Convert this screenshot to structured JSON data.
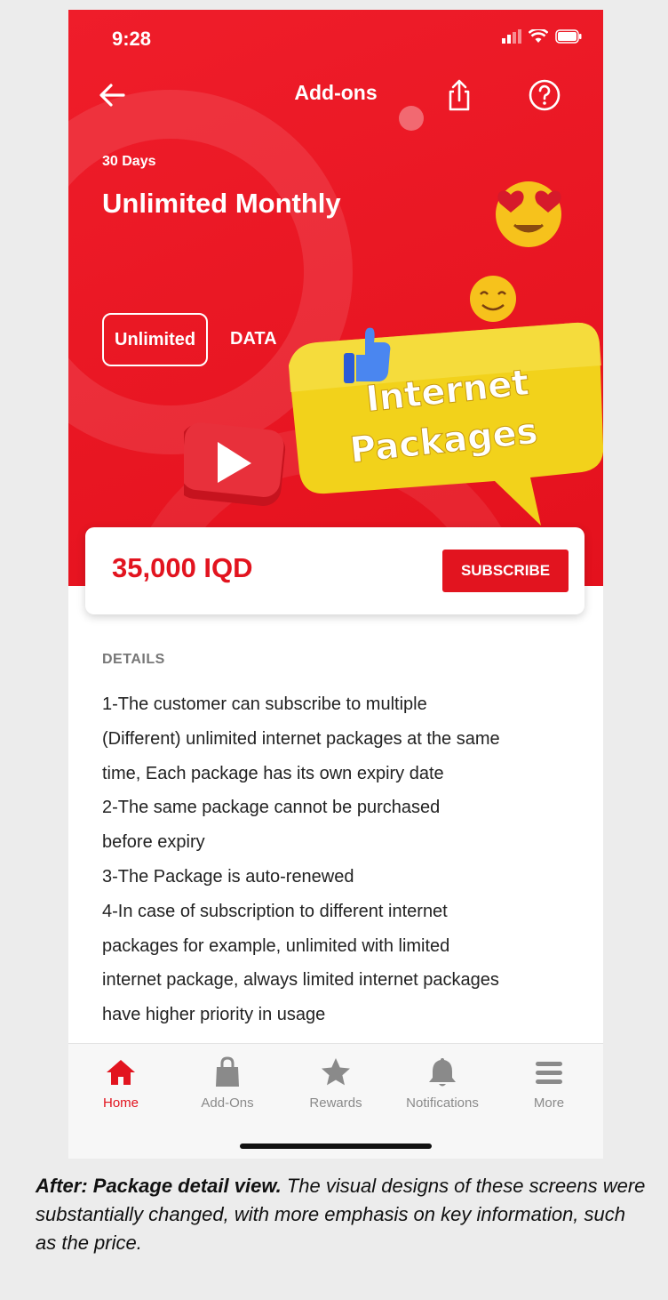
{
  "status": {
    "time": "9:28"
  },
  "header": {
    "title": "Add-ons"
  },
  "package": {
    "validity": "30 Days",
    "name": "Unlimited Monthly",
    "allowance_chip": "Unlimited",
    "allowance_type": "DATA",
    "price": "35,000 IQD",
    "subscribe_label": "SUBSCRIBE"
  },
  "promo": {
    "line1": "Internet",
    "line2": "Packages"
  },
  "details": {
    "heading": "DETAILS",
    "lines": [
      "1-The customer can subscribe to multiple",
      "(Different) unlimited internet packages at the same",
      "time, Each package has its own expiry date",
      "2-The same package cannot be purchased",
      "before expiry",
      "3-The Package is auto-renewed",
      "4-In case of subscription to different internet",
      "packages for example, unlimited with limited",
      "internet package, always limited internet packages",
      "have higher priority in usage"
    ]
  },
  "tabs": [
    {
      "label": "Home",
      "icon": "home-icon",
      "active": true
    },
    {
      "label": "Add-Ons",
      "icon": "shopping-bag-icon",
      "active": false
    },
    {
      "label": "Rewards",
      "icon": "star-icon",
      "active": false
    },
    {
      "label": "Notifications",
      "icon": "bell-icon",
      "active": false
    },
    {
      "label": "More",
      "icon": "menu-icon",
      "active": false
    }
  ],
  "caption": {
    "lead": "After: Package detail view.",
    "text": " The visual designs of these screens were substantially changed, with more emphasis on key information, such as the price."
  },
  "colors": {
    "brand_red": "#e2141f",
    "promo_yellow": "#f2d21b",
    "inactive_gray": "#8a8a8a"
  }
}
